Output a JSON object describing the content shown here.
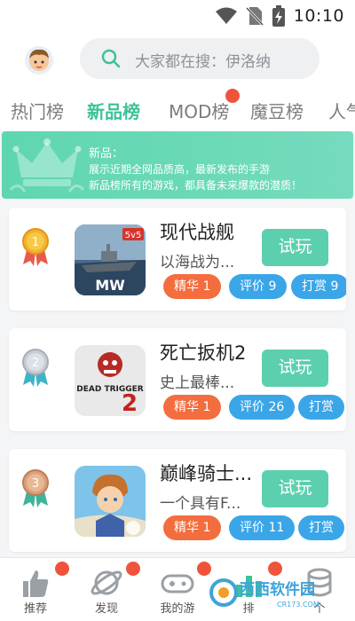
{
  "status": {
    "time": "10:10"
  },
  "search": {
    "placeholder": "大家都在搜：伊洛纳"
  },
  "tabs": [
    {
      "label": "热门榜"
    },
    {
      "label": "新品榜"
    },
    {
      "label": "MOD榜"
    },
    {
      "label": "魔豆榜"
    },
    {
      "label": "人气"
    }
  ],
  "banner": {
    "title": "新品：",
    "line1": "展示近期全网品质高，最新发布的手游",
    "line2": "新品榜所有的游戏，都具备未来爆款的潜质！"
  },
  "games": [
    {
      "rank": "1",
      "name": "现代战舰",
      "desc": "以海战为...",
      "try": "试玩",
      "tag1": "精华 1",
      "tag2": "评价 9",
      "tag3": "打赏 9",
      "icon_text": "MW",
      "icon_badge": "5v5"
    },
    {
      "rank": "2",
      "name": "死亡扳机2",
      "desc": "史上最棒...",
      "try": "试玩",
      "tag1": "精华 1",
      "tag2": "评价 26",
      "tag3": "打赏",
      "icon_text": "DEAD TRIGGER",
      "icon_badge": "2"
    },
    {
      "rank": "3",
      "name": "巅峰骑士...",
      "desc": "一个具有F...",
      "try": "试玩",
      "tag1": "精华 1",
      "tag2": "评价 11",
      "tag3": "打赏",
      "icon_text": "",
      "icon_badge": ""
    }
  ],
  "nav": [
    {
      "label": "推荐"
    },
    {
      "label": "发现"
    },
    {
      "label": "我的游"
    },
    {
      "label": "排"
    },
    {
      "label": "个"
    }
  ],
  "watermark": {
    "text": "西西软件园",
    "url": "CR173.COM"
  },
  "colors": {
    "accent": "#3cc29a",
    "try_button": "#5ccfae",
    "tag_orange": "#f46d3e",
    "tag_blue": "#3aa6e8",
    "dot_red": "#f0533c"
  }
}
